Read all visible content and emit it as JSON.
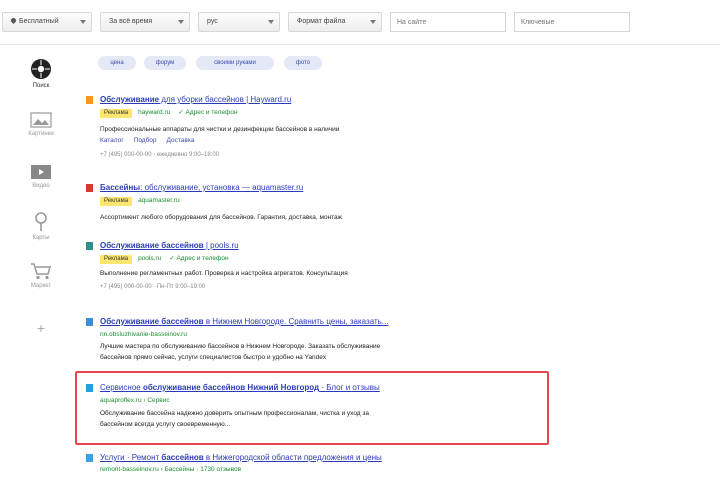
{
  "filters": {
    "region": "Бесплатный",
    "time": "За всё время",
    "lang": "рус",
    "format": "Формат файла",
    "site_placeholder": "На сайте",
    "keyword_placeholder": "Ключевые"
  },
  "nav": [
    {
      "label": "Поиск",
      "icon": "search-icon"
    },
    {
      "label": "Картинки",
      "icon": "images-icon"
    },
    {
      "label": "Видео",
      "icon": "video-icon"
    },
    {
      "label": "Карты",
      "icon": "map-pin-icon"
    },
    {
      "label": "Маркет",
      "icon": "cart-icon"
    },
    {
      "label": "+",
      "icon": "plus-icon"
    }
  ],
  "pills": [
    "цена",
    "форум",
    "своими руками",
    "фото"
  ],
  "results": [
    {
      "title_bold": "Обслуживание",
      "title_rest": " для уборки бассейнов | Hayward.ru",
      "ad": "Реклама",
      "url": "hayward.ru",
      "verified": "✓ Адрес и телефон",
      "snippet": "Профессиональные аппараты для чистки и дезинфекции бассейнов в наличии",
      "links": [
        "Каталог",
        "Подбор",
        "Доставка"
      ],
      "contact": "+7 (495) 000-00-00 · ежедневно 9:00–18:00"
    },
    {
      "title_bold": "Бассейны",
      "title_rest": ": обслуживание, установка — aquamaster.ru",
      "ad": "Реклама",
      "url": "aquamaster.ru",
      "snippet": "Ассортимент любого оборудования для бассейнов. Гарантия, доставка, монтаж"
    },
    {
      "title_bold": "Обслуживание бассейнов",
      "title_rest": " | pools.ru",
      "ad": "Реклама",
      "url": "pools.ru",
      "verified": "✓ Адрес и телефон",
      "snippet": "Выполнение регламентных работ. Проверка и настройка агрегатов. Консультация",
      "contact": "+7 (495) 000-00-00 · Пн-Пт 9:00–19:00"
    },
    {
      "title_bold": "Обслуживание бассейнов",
      "title_rest": " в Нижнем Новгороде. Сравнить цены, заказать...",
      "url": "nn.obsluzhivanie-basseinov.ru",
      "snippet": "Лучшие мастера по обслуживанию бассейнов в Нижнем Новгороде. Заказать обслуживание",
      "snippet2": "бассейнов прямо сейчас, услуги специалистов быстро и удобно на Yandex"
    },
    {
      "title_pre": "Сервисное ",
      "title_bold": "обслуживание бассейнов Нижний Новгород",
      "title_rest": " · Блог и отзывы",
      "url": "aquaproflex.ru › Сервис",
      "snippet": "Обслуживание бассейна надежно доверить опытным профессионалам, чистка и уход за",
      "snippet2": "бассейном всегда услугу своевременную..."
    },
    {
      "title_pre": "Услуги · Ремонт ",
      "title_bold": "бассейнов",
      "title_rest": " в Нижегородской области предложения и цены",
      "url": "remont-basseinov.ru › Бассейны · 1730 отзывов"
    }
  ]
}
